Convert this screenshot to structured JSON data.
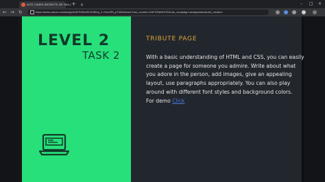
{
  "browser": {
    "tab_title": "ALTE CASES INFOBYTE INT SKILL",
    "tab_close": "×",
    "new_tab": "+",
    "window_controls": [
      "–",
      "□",
      "×"
    ],
    "nav": {
      "back": "←",
      "forward": "→",
      "reload": "↻"
    },
    "url": "https://www.canva.com/design/DAFSZMvIRCE/8lIbq_Z-2JmrZRl_jrTbt/Nviews/?utm_content=DAFSZMvIRCE&utm_campaign=designshare&utm_medium"
  },
  "panel": {
    "level": "LEVEL 2",
    "task": "TASK 2"
  },
  "content": {
    "title": "TRIBUTE PAGE",
    "lines": [
      "With a basic understanding of HTML and CSS, you can easily",
      "create a page for someone you admire. Write about what",
      "you adore in the person, add images, give an appealing",
      "layout, use paragraphs appropriately. You can also play",
      "around with different font styles and background colors."
    ],
    "demo_prefix": "For demo ",
    "demo_link": "Click"
  },
  "colors": {
    "green": "#27e07a",
    "dark_text": "#123b2a",
    "accent": "#e0a83a",
    "link": "#4a78e0"
  },
  "icons": {
    "laptop": "laptop-icon",
    "lock": "lock-icon"
  }
}
